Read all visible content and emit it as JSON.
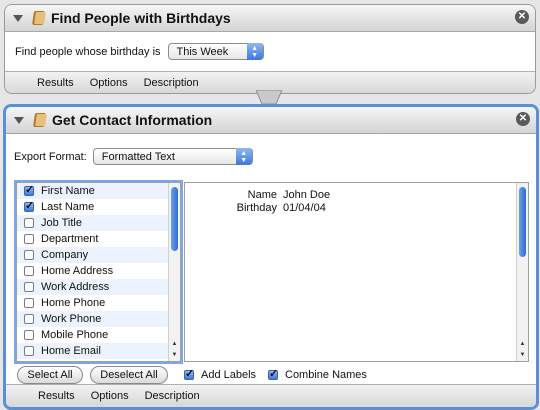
{
  "action1": {
    "title": "Find People with Birthdays",
    "find_label": "Find people whose birthday is",
    "period_value": "This Week",
    "tabs": [
      "Results",
      "Options",
      "Description"
    ]
  },
  "action2": {
    "title": "Get Contact Information",
    "export_label": "Export Format:",
    "export_value": "Formatted Text",
    "fields": [
      {
        "label": "First Name",
        "checked": true
      },
      {
        "label": "Last Name",
        "checked": true
      },
      {
        "label": "Job Title",
        "checked": false
      },
      {
        "label": "Department",
        "checked": false
      },
      {
        "label": "Company",
        "checked": false
      },
      {
        "label": "Home Address",
        "checked": false
      },
      {
        "label": "Work Address",
        "checked": false
      },
      {
        "label": "Home Phone",
        "checked": false
      },
      {
        "label": "Work Phone",
        "checked": false
      },
      {
        "label": "Mobile Phone",
        "checked": false
      },
      {
        "label": "Home Email",
        "checked": false
      }
    ],
    "output": {
      "name_key": "Name",
      "name_value": "John Doe",
      "birthday_key": "Birthday",
      "birthday_value": "01/04/04"
    },
    "select_all": "Select All",
    "deselect_all": "Deselect All",
    "add_labels": {
      "label": "Add Labels",
      "checked": true
    },
    "combine_names": {
      "label": "Combine Names",
      "checked": true
    },
    "tabs": [
      "Results",
      "Options",
      "Description"
    ]
  },
  "colors": {
    "accent": "#5b8fd6",
    "control": "#3c78d8"
  }
}
